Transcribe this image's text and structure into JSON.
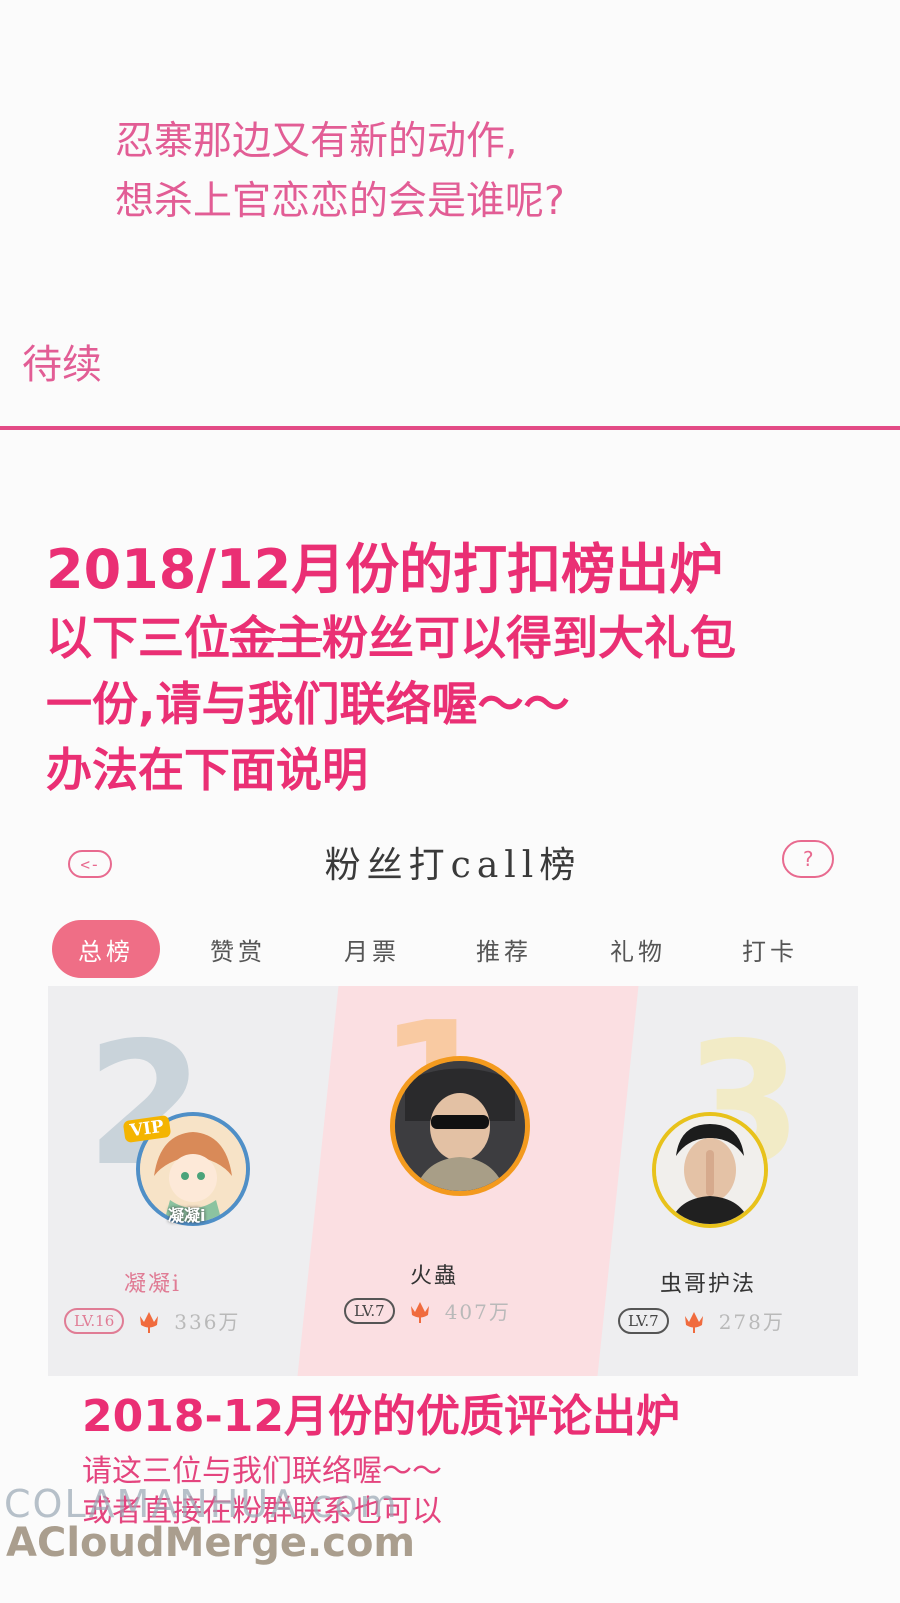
{
  "story": {
    "lines": [
      "忍寨那边又有新的动作,",
      "想杀上官恋恋的会是谁呢?"
    ],
    "to_be_continued": "待续"
  },
  "announcement": {
    "title": "2018/12月份的打扣榜出炉",
    "line1_pre": "以下三位",
    "line1_strike": "金主",
    "line1_post": "粉丝可以得到大礼包",
    "line2": "一份,请与我们联络喔～～",
    "line3": "办法在下面说明"
  },
  "panel": {
    "back_label": "<-",
    "title": "粉丝打call榜",
    "help_label": "?",
    "tabs": [
      {
        "label": "总榜",
        "active": true
      },
      {
        "label": "赞赏",
        "active": false
      },
      {
        "label": "月票",
        "active": false
      },
      {
        "label": "推荐",
        "active": false
      },
      {
        "label": "礼物",
        "active": false
      },
      {
        "label": "打卡",
        "active": false
      }
    ],
    "ranks": [
      {
        "rank": "2",
        "name": "凝凝i",
        "level": "LV.16",
        "score": "336万",
        "badge": "VIP",
        "avatar_caption": "凝凝i",
        "number_color": "#c9d3da",
        "name_color": "#e07c95"
      },
      {
        "rank": "1",
        "name": "火蟲",
        "level": "LV.7",
        "score": "407万",
        "number_color": "#f9caa2",
        "name_color": "#333333"
      },
      {
        "rank": "3",
        "name": "虫哥护法",
        "level": "LV.7",
        "score": "278万",
        "number_color": "#f2ebc6",
        "name_color": "#333333"
      }
    ]
  },
  "comments": {
    "title": "2018-12月份的优质评论出炉",
    "line1": "请这三位与我们联络喔～～",
    "line2": "或者直接在粉群联系也可以"
  },
  "watermark": {
    "line1": "COLAMANHUA.com",
    "line2": "ACloudMerge.com"
  },
  "colors": {
    "accent": "#ea2f74",
    "story_text": "#e25d95",
    "tab_active": "#ef6e86"
  }
}
